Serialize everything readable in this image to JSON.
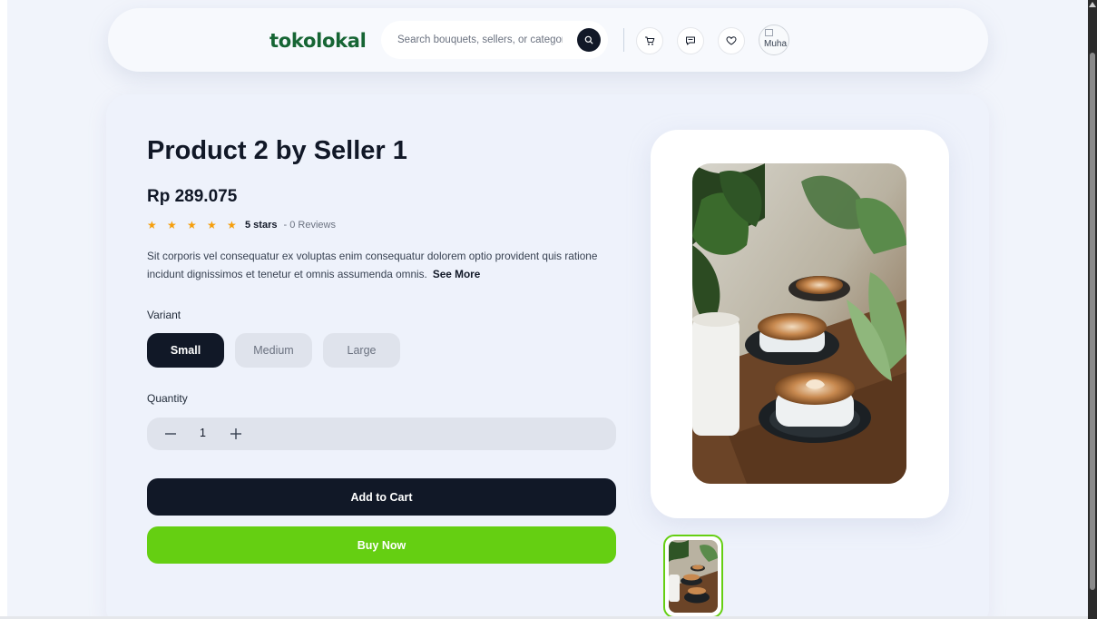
{
  "header": {
    "logo": "tokolokal",
    "search_placeholder": "Search bouquets, sellers, or categories",
    "icons": [
      "search-icon",
      "cart-icon",
      "chat-icon",
      "wishlist-icon"
    ],
    "avatar_alt": "Muha"
  },
  "product": {
    "title": "Product 2 by Seller 1",
    "price": "Rp 289.075",
    "rating": {
      "stars": 5,
      "stars_label": "5 stars",
      "reviews_label": "- 0 Reviews"
    },
    "description": "Sit corporis vel consequatur ex voluptas enim consequatur dolorem optio provident quis ratione incidunt dignissimos et tenetur et omnis assumenda omnis.",
    "see_more_label": "See More",
    "variant_label": "Variant",
    "variants": [
      {
        "label": "Small",
        "selected": true
      },
      {
        "label": "Medium",
        "selected": false
      },
      {
        "label": "Large",
        "selected": false
      }
    ],
    "quantity_label": "Quantity",
    "quantity": "1",
    "add_to_cart_label": "Add to Cart",
    "buy_now_label": "Buy Now"
  },
  "colors": {
    "brand_green": "#166534",
    "buy_now_green": "#65cf12",
    "dark": "#111827",
    "star": "#f59e0b"
  }
}
